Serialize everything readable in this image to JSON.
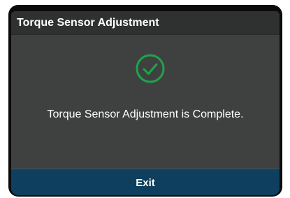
{
  "dialog": {
    "title": "Torque Sensor Adjustment",
    "icon": "check-circle-icon",
    "message": "Torque Sensor Adjustment is Complete.",
    "exit_label": "Exit"
  },
  "colors": {
    "background": "#3f4140",
    "title_bar": "#2f3130",
    "success": "#1fa34a",
    "exit_button": "#0e3f5e",
    "text": "#ffffff"
  }
}
